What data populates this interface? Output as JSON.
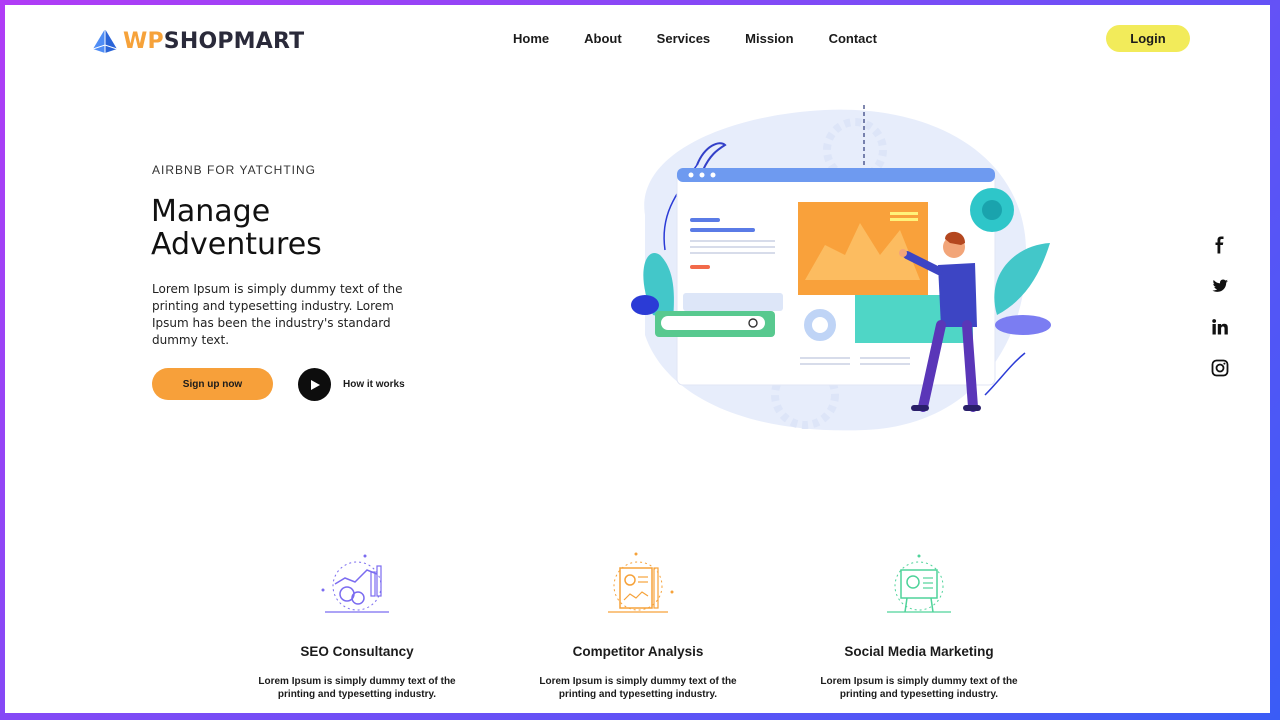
{
  "brand": {
    "prefix": "WP",
    "name": "SHOPMART",
    "accent": "#f6a23a",
    "logo_icon": "pyramid-icon"
  },
  "nav": {
    "items": [
      "Home",
      "About",
      "Services",
      "Mission",
      "Contact"
    ],
    "login_label": "Login"
  },
  "hero": {
    "eyebrow": "AIRBNB FOR YATCHTING",
    "title_line1": "Manage",
    "title_line2": "Adventures",
    "description": "Lorem Ipsum is simply dummy text of the printing and typesetting industry. Lorem Ipsum has been the industry's standard dummy text.",
    "signup_label": "Sign up now",
    "how_label": "How it works"
  },
  "social": [
    "facebook-icon",
    "twitter-icon",
    "linkedin-icon",
    "instagram-icon"
  ],
  "features": [
    {
      "title": "SEO Consultancy",
      "description": "Lorem Ipsum is simply dummy text of the printing and typesetting industry.",
      "color": "#7b6cf0",
      "icon": "seo-chart-icon"
    },
    {
      "title": "Competitor Analysis",
      "description": "Lorem Ipsum is simply dummy text of the printing and typesetting industry.",
      "color": "#f6a23a",
      "icon": "analysis-report-icon"
    },
    {
      "title": "Social Media Marketing",
      "description": "Lorem Ipsum is simply dummy text of the printing and typesetting industry.",
      "color": "#4fd39a",
      "icon": "presentation-board-icon"
    }
  ],
  "colors": {
    "accent_yellow": "#f2eb5a",
    "accent_orange": "#f7a03a",
    "gradient_start": "#b13cf6",
    "gradient_end": "#3a5cf6"
  }
}
